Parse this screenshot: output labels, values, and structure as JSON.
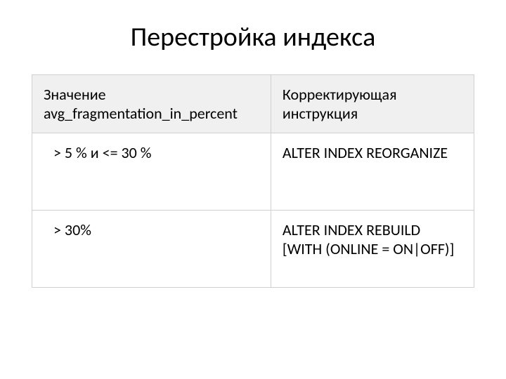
{
  "title": "Перестройка индекса",
  "table": {
    "headers": {
      "col1": "Значение avg_fragmentation_in_percent",
      "col2": "Корректирующая инструкция"
    },
    "rows": [
      {
        "condition": "> 5 % и <= 30 %",
        "action": "ALTER INDEX REORGANIZE"
      },
      {
        "condition": "> 30%",
        "action": "ALTER INDEX REBUILD [WITH (ONLINE = ON|OFF)]"
      }
    ]
  }
}
